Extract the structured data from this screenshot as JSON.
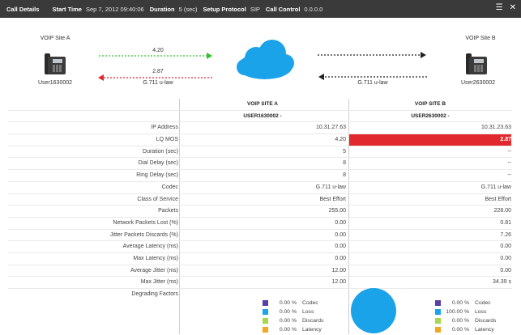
{
  "header": {
    "title": "Call Details",
    "start_time_label": "Start Time",
    "start_time": "Sep 7, 2012 09:40:06",
    "duration_label": "Duration",
    "duration": "5 (sec)",
    "setup_protocol_label": "Setup Protocol",
    "setup_protocol": "SIP",
    "call_control_label": "Call Control",
    "call_control": "0.0.0.0"
  },
  "diagram": {
    "site_a": "VOIP Site A",
    "site_b": "VOIP Site B",
    "user_a": "User1630002",
    "user_b": "User2630002",
    "a_to_b_value": "4.20",
    "b_to_a_value": "2.87",
    "codec_left": "G.711 u-law",
    "codec_right": "G.711 u-law",
    "colors": {
      "green": "#2dc52d",
      "red": "#e0282e",
      "cloud": "#1aa3e8"
    }
  },
  "table": {
    "col_a_title": "VOIP SITE A",
    "col_b_title": "VOIP SITE B",
    "col_a_user": "USER1630002 -",
    "col_b_user": "USER2630002 -",
    "rows": [
      {
        "label": "IP Address",
        "a": "10.31.27.63",
        "b": "10.31.23.63"
      },
      {
        "label": "LQ MOS",
        "a": "4.20",
        "b": "2.87"
      },
      {
        "label": "Duration (sec)",
        "a": "5",
        "b": "--"
      },
      {
        "label": "Dial Delay (sec)",
        "a": "8",
        "b": "--"
      },
      {
        "label": "Ring Delay (sec)",
        "a": "8",
        "b": "--"
      },
      {
        "label": "Codec",
        "a": "G.711 u-law",
        "b": "G.711 u-law"
      },
      {
        "label": "Class of Service",
        "a": "Best Effort",
        "b": "Best Effort"
      },
      {
        "label": "Packets",
        "a": "255.00",
        "b": "228.00"
      },
      {
        "label": "Network Packets Lost (%)",
        "a": "0.00",
        "b": "0.81"
      },
      {
        "label": "Jitter Packets Discards (%)",
        "a": "0.00",
        "b": "7.26"
      },
      {
        "label": "Average Latency (ms)",
        "a": "0.00",
        "b": "0.00"
      },
      {
        "label": "Max Latency (ms)",
        "a": "0.00",
        "b": "0.00"
      },
      {
        "label": "Average Jitter (ms)",
        "a": "12.00",
        "b": "0.00"
      },
      {
        "label": "Max Jitter (ms)",
        "a": "12.00",
        "b": "34.39 s"
      }
    ],
    "degrading_label": "Degrading Factors",
    "legend_a": [
      {
        "pct": "0.00 %",
        "name": "Codec",
        "color": "#5b3fa8"
      },
      {
        "pct": "0.00 %",
        "name": "Loss",
        "color": "#1aa3e8"
      },
      {
        "pct": "0.00 %",
        "name": "Discards",
        "color": "#a8d84a"
      },
      {
        "pct": "0.00 %",
        "name": "Latency",
        "color": "#f5a623"
      }
    ],
    "legend_b": [
      {
        "pct": "0.00 %",
        "name": "Codec",
        "color": "#5b3fa8"
      },
      {
        "pct": "100.00 %",
        "name": "Loss",
        "color": "#1aa3e8"
      },
      {
        "pct": "0.00 %",
        "name": "Discards",
        "color": "#a8d84a"
      },
      {
        "pct": "0.00 %",
        "name": "Latency",
        "color": "#f5a623"
      }
    ]
  }
}
